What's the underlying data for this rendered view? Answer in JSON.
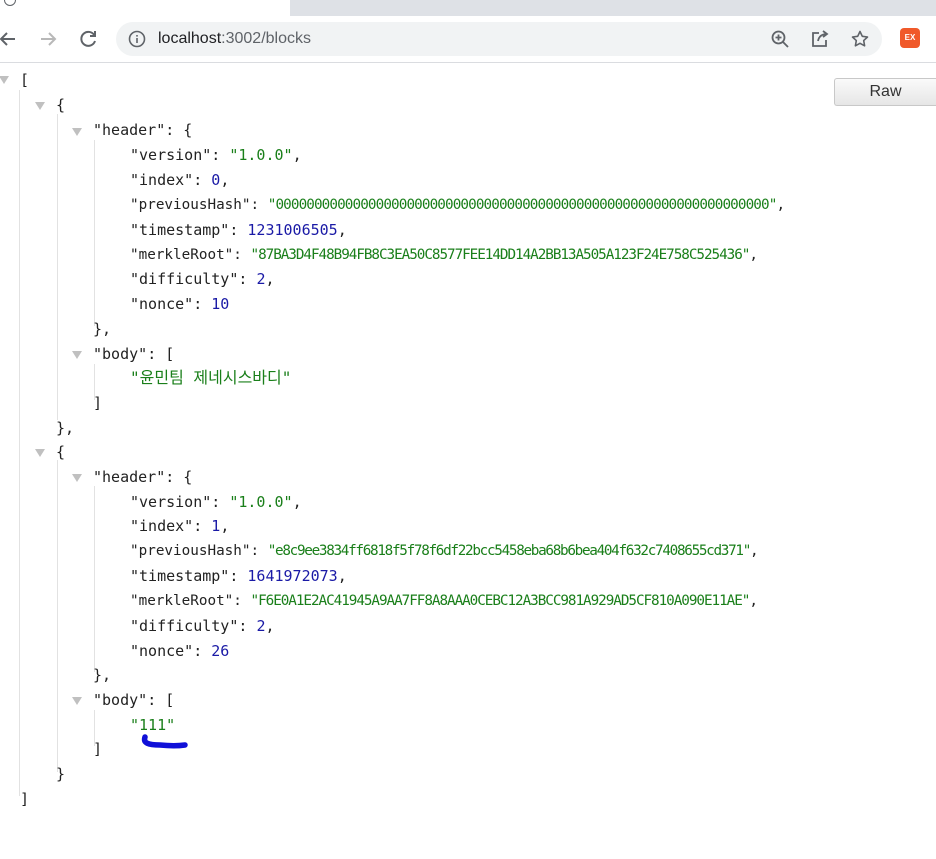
{
  "browser": {
    "url_host": "localhost",
    "url_path": ":3002/blocks",
    "extension_label": "EX",
    "icons": [
      "back-icon",
      "forward-icon",
      "reload-icon",
      "info-icon",
      "zoom-icon",
      "share-icon",
      "star-icon"
    ]
  },
  "viewer": {
    "raw_label": "Raw"
  },
  "blocks": [
    {
      "header": {
        "version": "\"1.0.0\"",
        "index": "0",
        "previousHash": "\"0000000000000000000000000000000000000000000000000000000000000000\"",
        "timestamp": "1231006505",
        "merkleRoot": "\"87BA3D4F48B94FB8C3EA50C8577FEE14DD14A2BB13A505A123F24E758C525436\"",
        "difficulty": "2",
        "nonce": "10"
      },
      "body": [
        "\"윤민팀 제네시스바디\""
      ]
    },
    {
      "header": {
        "version": "\"1.0.0\"",
        "index": "1",
        "previousHash": "\"e8c9ee3834ff6818f5f78f6df22bcc5458eba68b6bea404f632c7408655cd371\"",
        "timestamp": "1641972073",
        "merkleRoot": "\"F6E0A1E2AC41945A9AA7FF8A8AAA0CEBC12A3BCC981A929AD5CF810A090E11AE\"",
        "difficulty": "2",
        "nonce": "26"
      },
      "body": [
        "\"111\""
      ]
    }
  ],
  "colors": {
    "string": "#1a7f1a",
    "number": "#1a1aa6",
    "annotation": "#1010d8"
  }
}
